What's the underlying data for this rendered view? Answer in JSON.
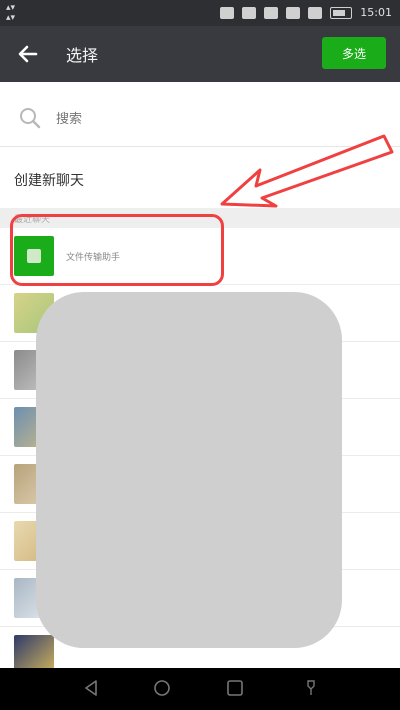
{
  "header": {
    "title": "选择",
    "multi_select_label": "多选"
  },
  "search": {
    "placeholder": "搜索"
  },
  "new_chat_label": "创建新聊天",
  "section_label": "最近聊天",
  "list": {
    "first_item_label": "文件传输助手"
  },
  "status_bar": {
    "time": "15:01"
  },
  "colors": {
    "accent": "#1aad19",
    "titlebar": "#393a3f",
    "annotation": "#f04040"
  }
}
